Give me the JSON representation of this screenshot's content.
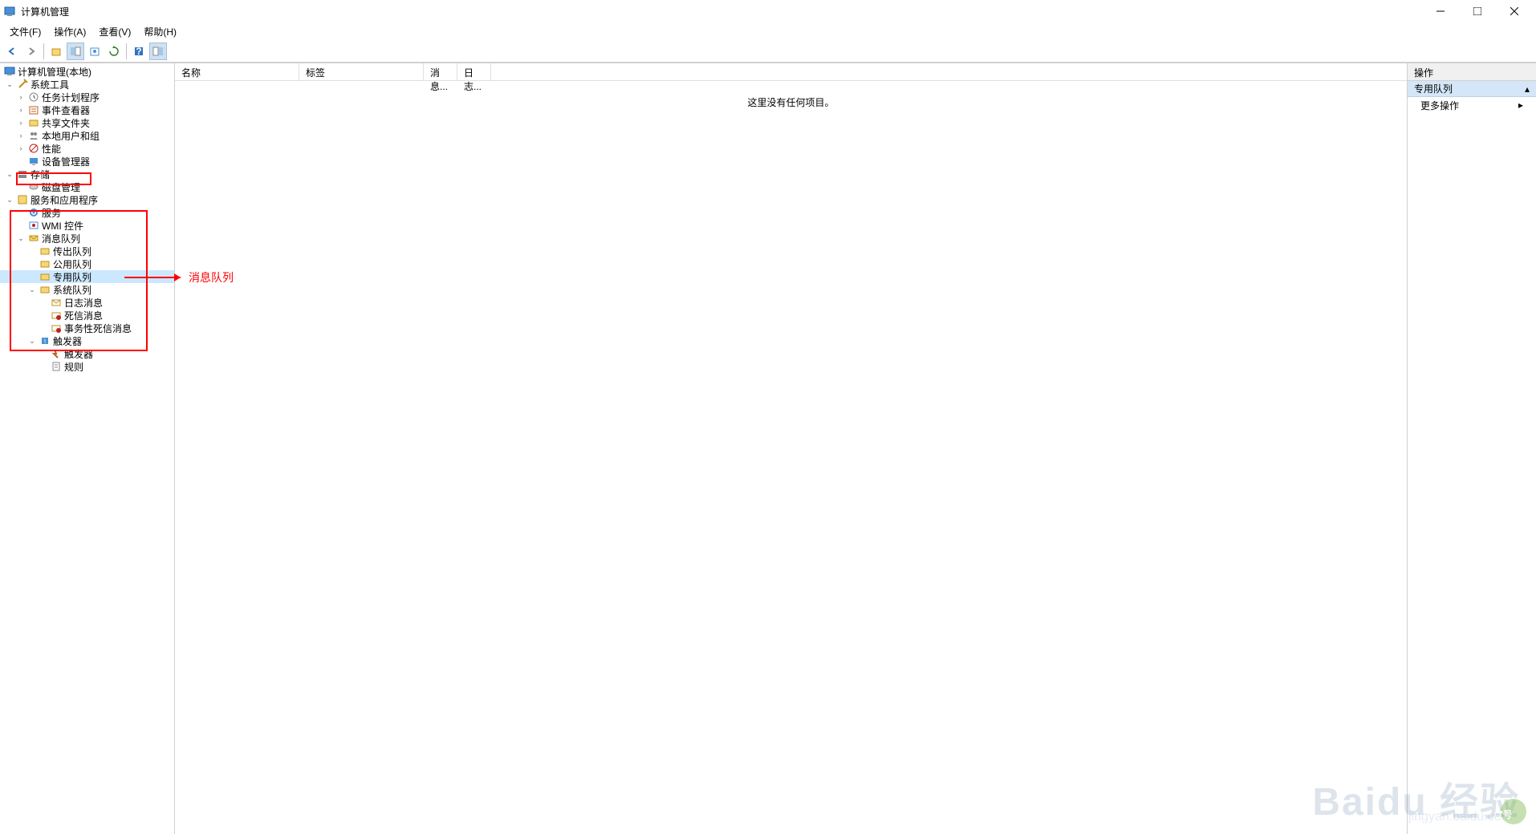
{
  "window": {
    "title": "计算机管理"
  },
  "menu": {
    "file": "文件(F)",
    "action": "操作(A)",
    "view": "查看(V)",
    "help": "帮助(H)"
  },
  "tree": {
    "root": "计算机管理(本地)",
    "system_tools": "系统工具",
    "task_scheduler": "任务计划程序",
    "event_viewer": "事件查看器",
    "shared_folders": "共享文件夹",
    "local_users": "本地用户和组",
    "performance": "性能",
    "device_manager": "设备管理器",
    "storage": "存储",
    "disk_management": "磁盘管理",
    "services_apps": "服务和应用程序",
    "services": "服务",
    "wmi_control": "WMI 控件",
    "message_queuing": "消息队列",
    "outgoing_queues": "传出队列",
    "public_queues": "公用队列",
    "private_queues": "专用队列",
    "system_queues": "系统队列",
    "journal_messages": "日志消息",
    "dead_letter": "死信消息",
    "trans_dead_letter": "事务性死信消息",
    "triggers": "触发器",
    "triggers_sub": "触发器",
    "rules": "规则"
  },
  "list": {
    "col_name": "名称",
    "col_label": "标签",
    "col_message": "消息...",
    "col_log": "日志...",
    "empty": "这里没有任何项目。"
  },
  "actions": {
    "header": "操作",
    "section": "专用队列",
    "more": "更多操作"
  },
  "annotation": {
    "text": "消息队列"
  },
  "watermark": {
    "main": "Baidu 经验",
    "sub": "jingyan.baidu.com"
  }
}
